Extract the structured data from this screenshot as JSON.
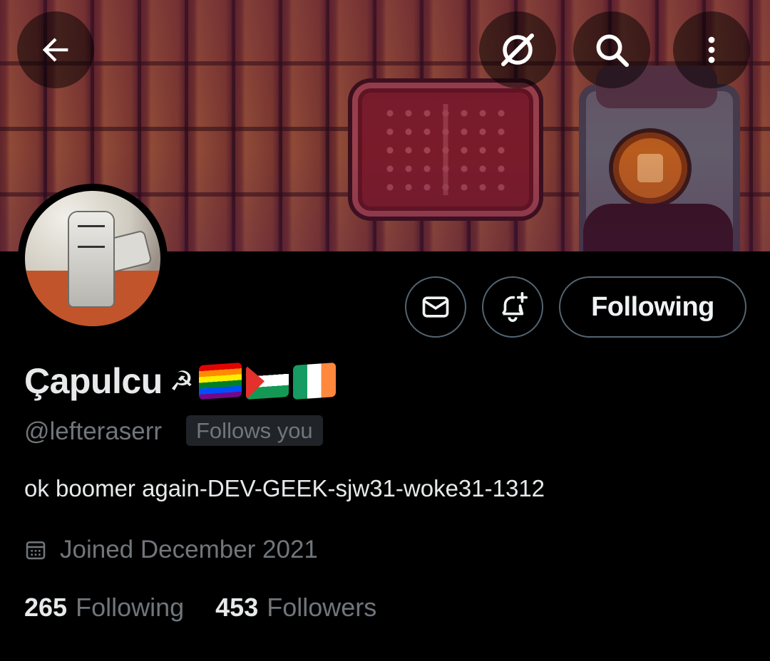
{
  "header": {
    "back_icon": "arrow-left-icon",
    "grok_icon": "grok-icon",
    "search_icon": "search-icon",
    "more_icon": "more-vertical-icon"
  },
  "actions": {
    "message_icon": "envelope-icon",
    "notify_icon": "bell-plus-icon",
    "follow_label": "Following"
  },
  "profile": {
    "name": "Çapulcu",
    "name_emojis": [
      "hammer-and-sickle",
      "rainbow-flag",
      "palestine-flag",
      "ireland-flag"
    ],
    "hammer_symbol": "☭",
    "handle": "@lefteraserr",
    "follows_you": "Follows you",
    "bio": "ok boomer again-DEV-GEEK-sjw31-woke31-1312",
    "joined": "Joined December 2021",
    "following_count": "265",
    "following_label": "Following",
    "followers_count": "453",
    "followers_label": "Followers"
  },
  "colors": {
    "background": "#000000",
    "text_primary": "#e7e9ea",
    "text_secondary": "#71767b",
    "border": "#536471",
    "badge_bg": "#202327"
  }
}
